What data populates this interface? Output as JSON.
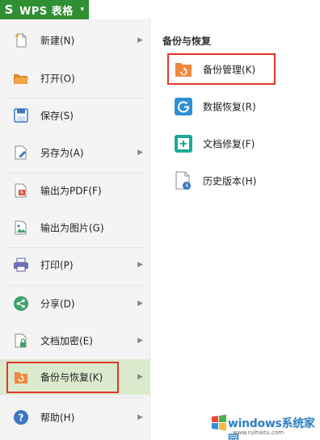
{
  "app": {
    "title": "WPS 表格",
    "logo": "S",
    "dropdown": "▾"
  },
  "menu": {
    "items": [
      {
        "label": "新建(N)",
        "has_submenu": true,
        "icon": "new-file-icon"
      },
      {
        "label": "打开(O)",
        "has_submenu": false,
        "icon": "open-folder-icon"
      },
      {
        "label": "保存(S)",
        "has_submenu": false,
        "icon": "save-icon"
      },
      {
        "label": "另存为(A)",
        "has_submenu": true,
        "icon": "save-as-icon"
      },
      {
        "label": "输出为PDF(F)",
        "has_submenu": false,
        "icon": "export-pdf-icon"
      },
      {
        "label": "输出为图片(G)",
        "has_submenu": false,
        "icon": "export-image-icon"
      },
      {
        "label": "打印(P)",
        "has_submenu": true,
        "icon": "print-icon"
      },
      {
        "label": "分享(D)",
        "has_submenu": true,
        "icon": "share-icon"
      },
      {
        "label": "文档加密(E)",
        "has_submenu": true,
        "icon": "encrypt-icon"
      },
      {
        "label": "备份与恢复(K)",
        "has_submenu": true,
        "active": true,
        "icon": "backup-restore-icon"
      },
      {
        "label": "帮助(H)",
        "has_submenu": true,
        "icon": "help-icon"
      }
    ],
    "arrow": "▶"
  },
  "submenu": {
    "title": "备份与恢复",
    "items": [
      {
        "label": "备份管理(K)",
        "icon": "backup-manage-icon"
      },
      {
        "label": "数据恢复(R)",
        "icon": "data-recovery-icon"
      },
      {
        "label": "文档修复(F)",
        "icon": "doc-repair-icon"
      },
      {
        "label": "历史版本(H)",
        "icon": "history-version-icon"
      }
    ]
  },
  "watermark": {
    "text": "windows系统家园",
    "url": "www.ruihaitu.com"
  },
  "colors": {
    "app_green": "#2f8f32",
    "active_bg": "#dbe9cd",
    "highlight": "#e2382b",
    "orange": "#f0883c",
    "blue": "#2e7fc2",
    "teal": "#1fa99a"
  }
}
